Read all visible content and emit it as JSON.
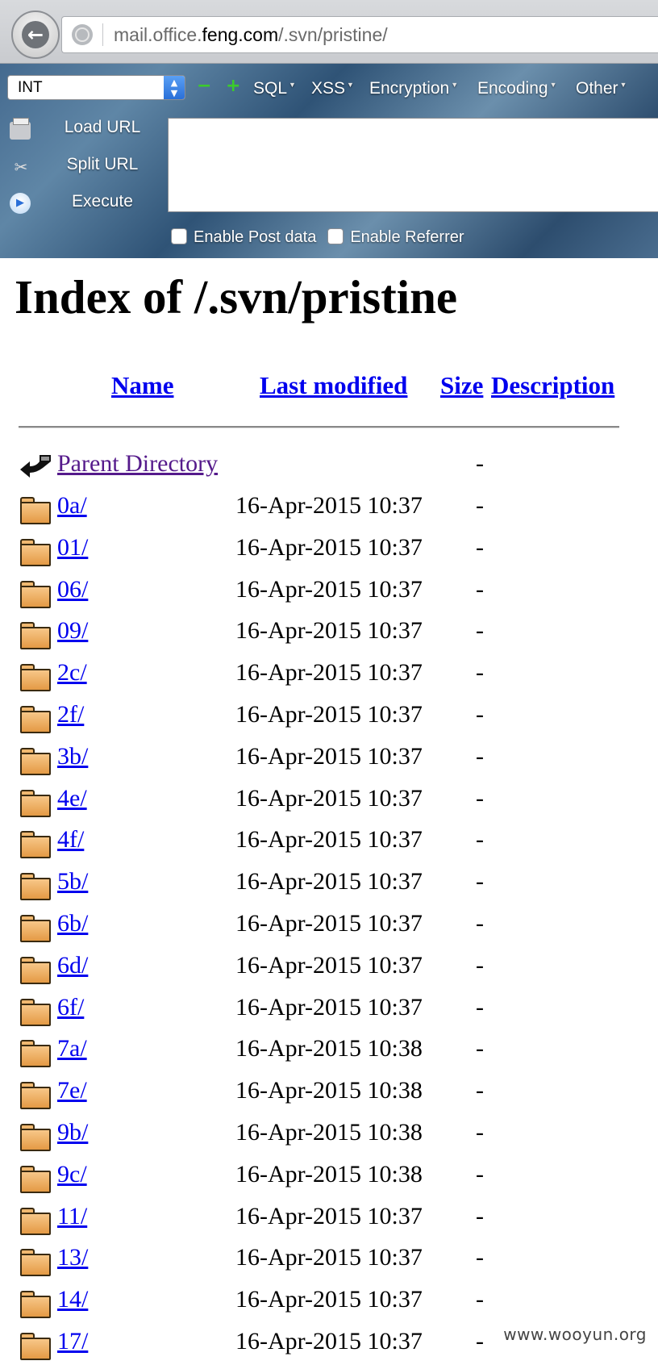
{
  "browser": {
    "url_prefix": "mail.office.",
    "url_domain": "feng.com",
    "url_path": "/.svn/pristine/"
  },
  "hackbar": {
    "select_value": "INT",
    "menus": [
      "SQL",
      "XSS",
      "Encryption",
      "Encoding",
      "Other"
    ],
    "buttons": {
      "load_url": "Load URL",
      "split_url": "Split URL",
      "execute": "Execute"
    },
    "checkboxes": {
      "post_data": "Enable Post data",
      "referrer": "Enable Referrer"
    },
    "icons": {
      "minus": "minus-icon",
      "plus": "plus-icon"
    }
  },
  "listing": {
    "title": "Index of /.svn/pristine",
    "columns": {
      "name": "Name",
      "modified": "Last modified",
      "size": "Size",
      "description": "Description"
    },
    "parent": {
      "label": "Parent Directory",
      "size": "-"
    },
    "rows": [
      {
        "name": "0a/",
        "date": "16-Apr-2015 10:37",
        "size": "-"
      },
      {
        "name": "01/",
        "date": "16-Apr-2015 10:37",
        "size": "-"
      },
      {
        "name": "06/",
        "date": "16-Apr-2015 10:37",
        "size": "-"
      },
      {
        "name": "09/",
        "date": "16-Apr-2015 10:37",
        "size": "-"
      },
      {
        "name": "2c/",
        "date": "16-Apr-2015 10:37",
        "size": "-"
      },
      {
        "name": "2f/",
        "date": "16-Apr-2015 10:37",
        "size": "-"
      },
      {
        "name": "3b/",
        "date": "16-Apr-2015 10:37",
        "size": "-"
      },
      {
        "name": "4e/",
        "date": "16-Apr-2015 10:37",
        "size": "-"
      },
      {
        "name": "4f/",
        "date": "16-Apr-2015 10:37",
        "size": "-"
      },
      {
        "name": "5b/",
        "date": "16-Apr-2015 10:37",
        "size": "-"
      },
      {
        "name": "6b/",
        "date": "16-Apr-2015 10:37",
        "size": "-"
      },
      {
        "name": "6d/",
        "date": "16-Apr-2015 10:37",
        "size": "-"
      },
      {
        "name": "6f/",
        "date": "16-Apr-2015 10:37",
        "size": "-"
      },
      {
        "name": "7a/",
        "date": "16-Apr-2015 10:38",
        "size": "-"
      },
      {
        "name": "7e/",
        "date": "16-Apr-2015 10:38",
        "size": "-"
      },
      {
        "name": "9b/",
        "date": "16-Apr-2015 10:38",
        "size": "-"
      },
      {
        "name": "9c/",
        "date": "16-Apr-2015 10:38",
        "size": "-"
      },
      {
        "name": "11/",
        "date": "16-Apr-2015 10:37",
        "size": "-"
      },
      {
        "name": "13/",
        "date": "16-Apr-2015 10:37",
        "size": "-"
      },
      {
        "name": "14/",
        "date": "16-Apr-2015 10:37",
        "size": "-"
      },
      {
        "name": "17/",
        "date": "16-Apr-2015 10:37",
        "size": "-"
      }
    ]
  },
  "watermark": "www.wooyun.org",
  "colors": {
    "link": "#0000ee",
    "visited_link": "#551a8b",
    "folder": "#f0b870"
  }
}
